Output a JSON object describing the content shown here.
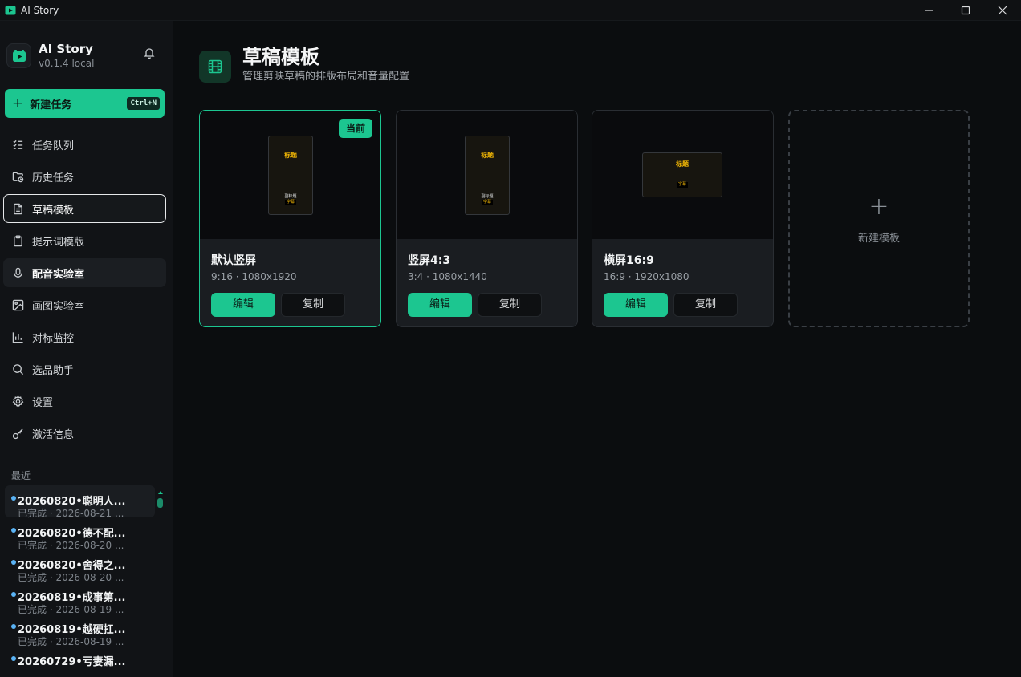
{
  "window": {
    "title": "AI Story"
  },
  "brand": {
    "name": "AI Story",
    "version": "v0.1.4 local"
  },
  "new_task": {
    "label": "新建任务",
    "shortcut": "Ctrl+N"
  },
  "nav": {
    "items": [
      {
        "label": "任务队列",
        "icon": "list-check-icon"
      },
      {
        "label": "历史任务",
        "icon": "folder-clock-icon"
      },
      {
        "label": "草稿模板",
        "icon": "file-text-icon",
        "state": "active"
      },
      {
        "label": "提示词模版",
        "icon": "clipboard-icon"
      },
      {
        "label": "配音实验室",
        "icon": "mic-icon",
        "state": "hover"
      },
      {
        "label": "画图实验室",
        "icon": "image-icon"
      },
      {
        "label": "对标监控",
        "icon": "bar-chart-icon"
      },
      {
        "label": "选品助手",
        "icon": "search-icon"
      },
      {
        "label": "设置",
        "icon": "gear-icon"
      },
      {
        "label": "激活信息",
        "icon": "key-icon"
      }
    ]
  },
  "recent": {
    "title": "最近",
    "items": [
      {
        "name": "20260820•聪明人...",
        "meta": "已完成 · 2026-08-21 ..."
      },
      {
        "name": "20260820•德不配...",
        "meta": "已完成 · 2026-08-20 ..."
      },
      {
        "name": "20260820•舍得之...",
        "meta": "已完成 · 2026-08-20 ..."
      },
      {
        "name": "20260819•成事第...",
        "meta": "已完成 · 2026-08-19 ..."
      },
      {
        "name": "20260819•越硬扛...",
        "meta": "已完成 · 2026-08-19 ..."
      },
      {
        "name": "20260729•亏妻漏...",
        "meta": ""
      }
    ]
  },
  "page": {
    "title": "草稿模板",
    "subtitle": "管理剪映草稿的排版布局和音量配置"
  },
  "preview_text": {
    "title": "标题",
    "subtitle": "副标题",
    "caption": "字幕"
  },
  "templates": [
    {
      "name": "默认竖屏",
      "spec": "9:16 · 1080x1920",
      "badge": "当前",
      "edit": "编辑",
      "copy": "复制"
    },
    {
      "name": "竖屏4:3",
      "spec": "3:4 · 1080x1440",
      "edit": "编辑",
      "copy": "复制"
    },
    {
      "name": "横屏16:9",
      "spec": "16:9 · 1920x1080",
      "edit": "编辑",
      "copy": "复制"
    }
  ],
  "new_template": {
    "label": "新建模板"
  },
  "colors": {
    "accent": "#1cc690",
    "background": "#0b0d0f",
    "sidebar": "#111316",
    "preview_title": "#f2b705",
    "dot": "#5ab3f5"
  }
}
